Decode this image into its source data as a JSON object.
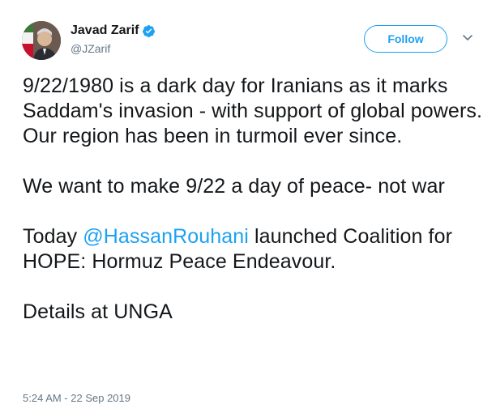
{
  "author": {
    "name": "Javad Zarif",
    "handle": "@JZarif",
    "verified": true
  },
  "actions": {
    "follow_label": "Follow",
    "menu_icon": "chevron-down-icon"
  },
  "tweet": {
    "paragraph_1": "9/22/1980 is a dark day for Iranians as it marks Saddam's invasion - with support of global powers. Our region has been in turmoil ever since.",
    "paragraph_2": "We want to make 9/22 a day of peace- not war",
    "paragraph_3_prefix": "Today ",
    "paragraph_3_mention": "@HassanRouhani",
    "paragraph_3_suffix": " launched Coalition for HOPE: Hormuz Peace Endeavour.",
    "paragraph_4": "Details at UNGA",
    "timestamp": "5:24 AM - 22 Sep 2019"
  },
  "colors": {
    "accent": "#1da1f2",
    "text": "#14171a",
    "muted": "#657786"
  }
}
